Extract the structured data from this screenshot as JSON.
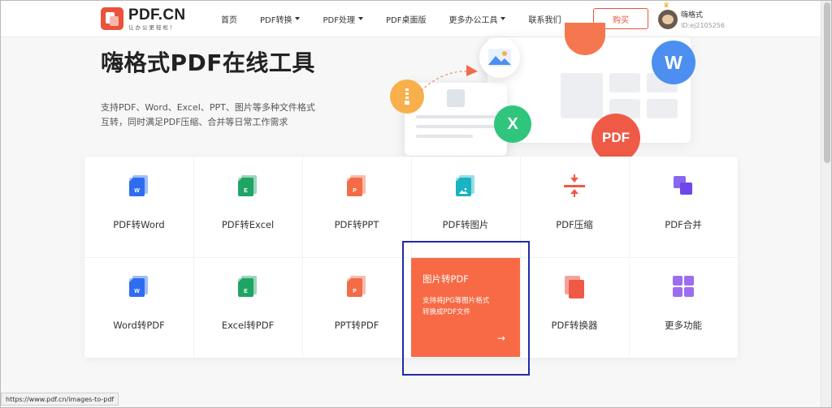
{
  "header": {
    "logo_name": "PDF.CN",
    "logo_slogan": "让办公更轻松！",
    "nav": [
      {
        "label": "首页",
        "has_dropdown": false
      },
      {
        "label": "PDF转换",
        "has_dropdown": true
      },
      {
        "label": "PDF处理",
        "has_dropdown": true
      },
      {
        "label": "PDF桌面版",
        "has_dropdown": false
      },
      {
        "label": "更多办公工具",
        "has_dropdown": true
      },
      {
        "label": "联系我们",
        "has_dropdown": false
      }
    ],
    "buy_label": "购买",
    "user_name": "嗨格式",
    "user_id": "ID:ej2105256"
  },
  "hero": {
    "title": "嗨格式PDF在线工具",
    "desc_line1": "支持PDF、Word、Excel、PPT、图片等多种文件格式",
    "desc_line2": "互转，同时满足PDF压缩、合并等日常工作需求"
  },
  "illustration": {
    "w_letter": "W",
    "x_letter": "X",
    "pdf_text": "PDF"
  },
  "tools": [
    {
      "label": "PDF转Word",
      "icon": "word-file-icon",
      "color": "#2f6df0",
      "letter": "W"
    },
    {
      "label": "PDF转Excel",
      "icon": "excel-file-icon",
      "color": "#1fa463",
      "letter": "E"
    },
    {
      "label": "PDF转PPT",
      "icon": "ppt-file-icon",
      "color": "#f36b47",
      "letter": "P"
    },
    {
      "label": "PDF转图片",
      "icon": "image-file-icon",
      "color": "#19b3c2",
      "letter": ""
    },
    {
      "label": "PDF压缩",
      "icon": "compress-icon",
      "color": "#ef5a46"
    },
    {
      "label": "PDF合并",
      "icon": "merge-icon",
      "color": "#7b57ee"
    },
    {
      "label": "Word转PDF",
      "icon": "word-file-icon",
      "color": "#2f6df0",
      "letter": "W"
    },
    {
      "label": "Excel转PDF",
      "icon": "excel-file-icon",
      "color": "#1fa463",
      "letter": "E"
    },
    {
      "label": "PPT转PDF",
      "icon": "ppt-file-icon",
      "color": "#f36b47",
      "letter": "P"
    },
    {
      "label": "PDF转换器",
      "icon": "converter-icon",
      "color": "#ef5a46"
    },
    {
      "label": "更多功能",
      "icon": "grid-icon",
      "color": "#9b6ef0"
    }
  ],
  "featured": {
    "title": "图片转PDF",
    "desc_line1": "支持将JPG等图片格式",
    "desc_line2": "转换成PDF文件",
    "arrow": "→",
    "color": "#f76a45"
  },
  "status_bar": {
    "url": "https://www.pdf.cn/images-to-pdf"
  }
}
